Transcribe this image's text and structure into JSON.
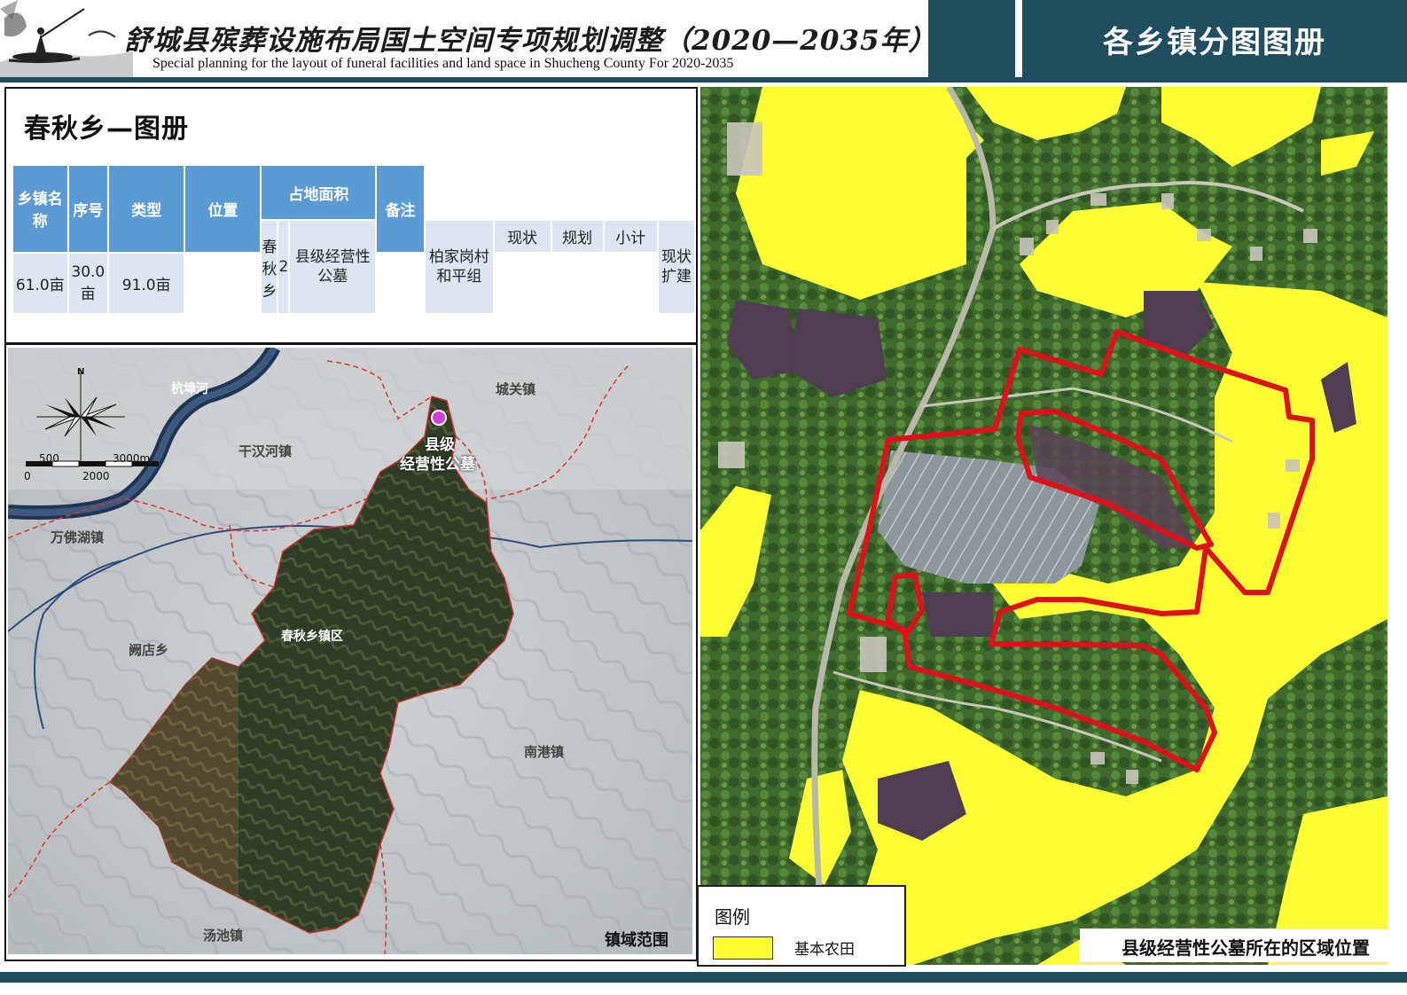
{
  "header": {
    "title_cn": "舒城县殡葬设施布局国土空间专项规划调整（2020—2035年）",
    "title_en": "Special planning for the layout of funeral facilities and land space in Shucheng County For 2020-2035",
    "right_title": "各乡镇分图图册"
  },
  "section": {
    "title": "春秋乡—图册"
  },
  "table": {
    "headers": {
      "town": "乡镇名称",
      "seq": "序号",
      "type": "类型",
      "location": "位置",
      "area": "占地面积",
      "note": "备注"
    },
    "subheaders": {
      "current": "现状",
      "planned": "规划",
      "subtotal": "小计"
    },
    "row": {
      "town": "春秋乡",
      "seq": "2",
      "type": "县级经营性公墓",
      "location": "柏家岗村和平组",
      "current": "61.0亩",
      "planned": "30.0亩",
      "subtotal": "91.0亩",
      "note": "现状扩建"
    }
  },
  "overview_map": {
    "labels": {
      "river": "杭埠河",
      "chengguan": "城关镇",
      "ganhanhe": "干汉河镇",
      "wanfohu": "万佛湖镇",
      "queidian": "阙店乡",
      "chunqiu": "春秋乡镇区",
      "nangang": "南港镇",
      "tangchi": "汤池镇",
      "site_line1": "县级",
      "site_line2": "经营性公墓",
      "caption": "镇域范围"
    },
    "compass": {
      "north": "N"
    },
    "scale": {
      "t0": "0",
      "t500": "500",
      "t2000": "2000",
      "t3000": "3000m"
    }
  },
  "detail_map": {
    "legend": {
      "title": "图例",
      "item": "基本农田",
      "item_color": "#ffff33"
    },
    "caption": "县级经营性公墓所在的区域位置",
    "boundary_color": "#e0101a"
  },
  "colors": {
    "brand": "#1f4e5e",
    "table_header": "#5b9bd5",
    "table_cell": "#dde5f2",
    "site_marker": "#d63ad8"
  }
}
